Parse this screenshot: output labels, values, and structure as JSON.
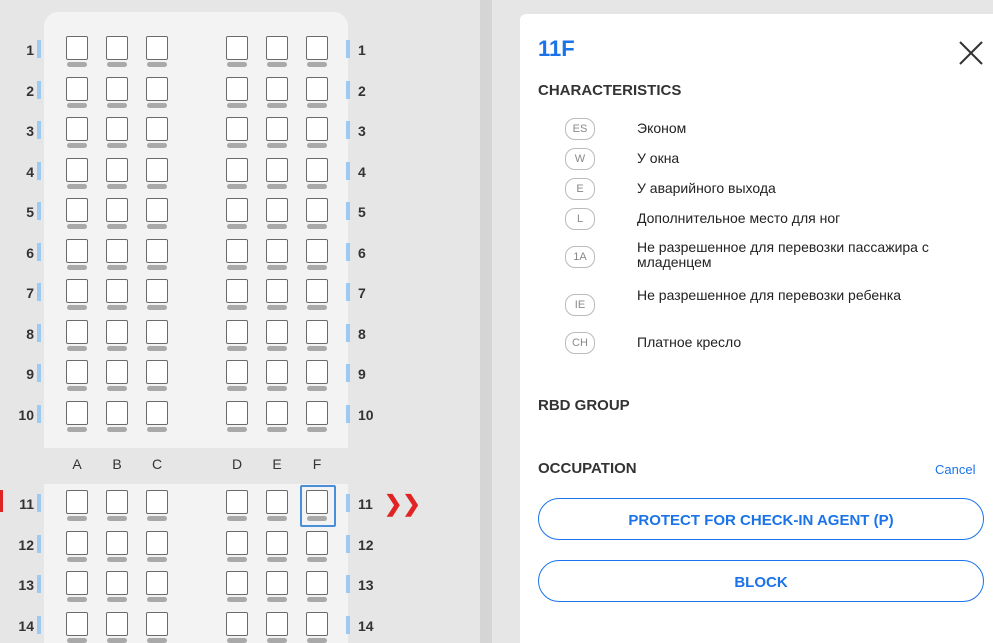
{
  "seatmap": {
    "columns_left": [
      "A",
      "B",
      "C"
    ],
    "columns_right": [
      "D",
      "E",
      "F"
    ],
    "rows_upper": [
      "1",
      "2",
      "3",
      "4",
      "5",
      "6",
      "7",
      "8",
      "9",
      "10"
    ],
    "rows_lower": [
      "11",
      "12",
      "13",
      "14"
    ],
    "selected_seat": "11F",
    "exit_row_marker": "❯❯"
  },
  "panel": {
    "seat_id": "11F",
    "close_icon": "close-icon",
    "characteristics_title": "CHARACTERISTICS",
    "characteristics": [
      {
        "code": "ES",
        "label": "Эконом"
      },
      {
        "code": "W",
        "label": "У окна"
      },
      {
        "code": "E",
        "label": "У аварийного выхода"
      },
      {
        "code": "L",
        "label": "Дополнительное место для ног"
      },
      {
        "code": "1A",
        "label": "Не разрешенное для перевозки пассажира с младенцем"
      },
      {
        "code": "IE",
        "label": "Не разрешенное для перевозки ребенка"
      },
      {
        "code": "CH",
        "label": "Платное кресло"
      }
    ],
    "rbd_group_title": "RBD GROUP",
    "occupation_title": "OCCUPATION",
    "cancel_label": "Cancel",
    "protect_label": "PROTECT FOR CHECK-IN AGENT (P)",
    "block_label": "BLOCK"
  },
  "colors": {
    "accent": "#1a73e8",
    "exit_marker": "#e02424"
  }
}
